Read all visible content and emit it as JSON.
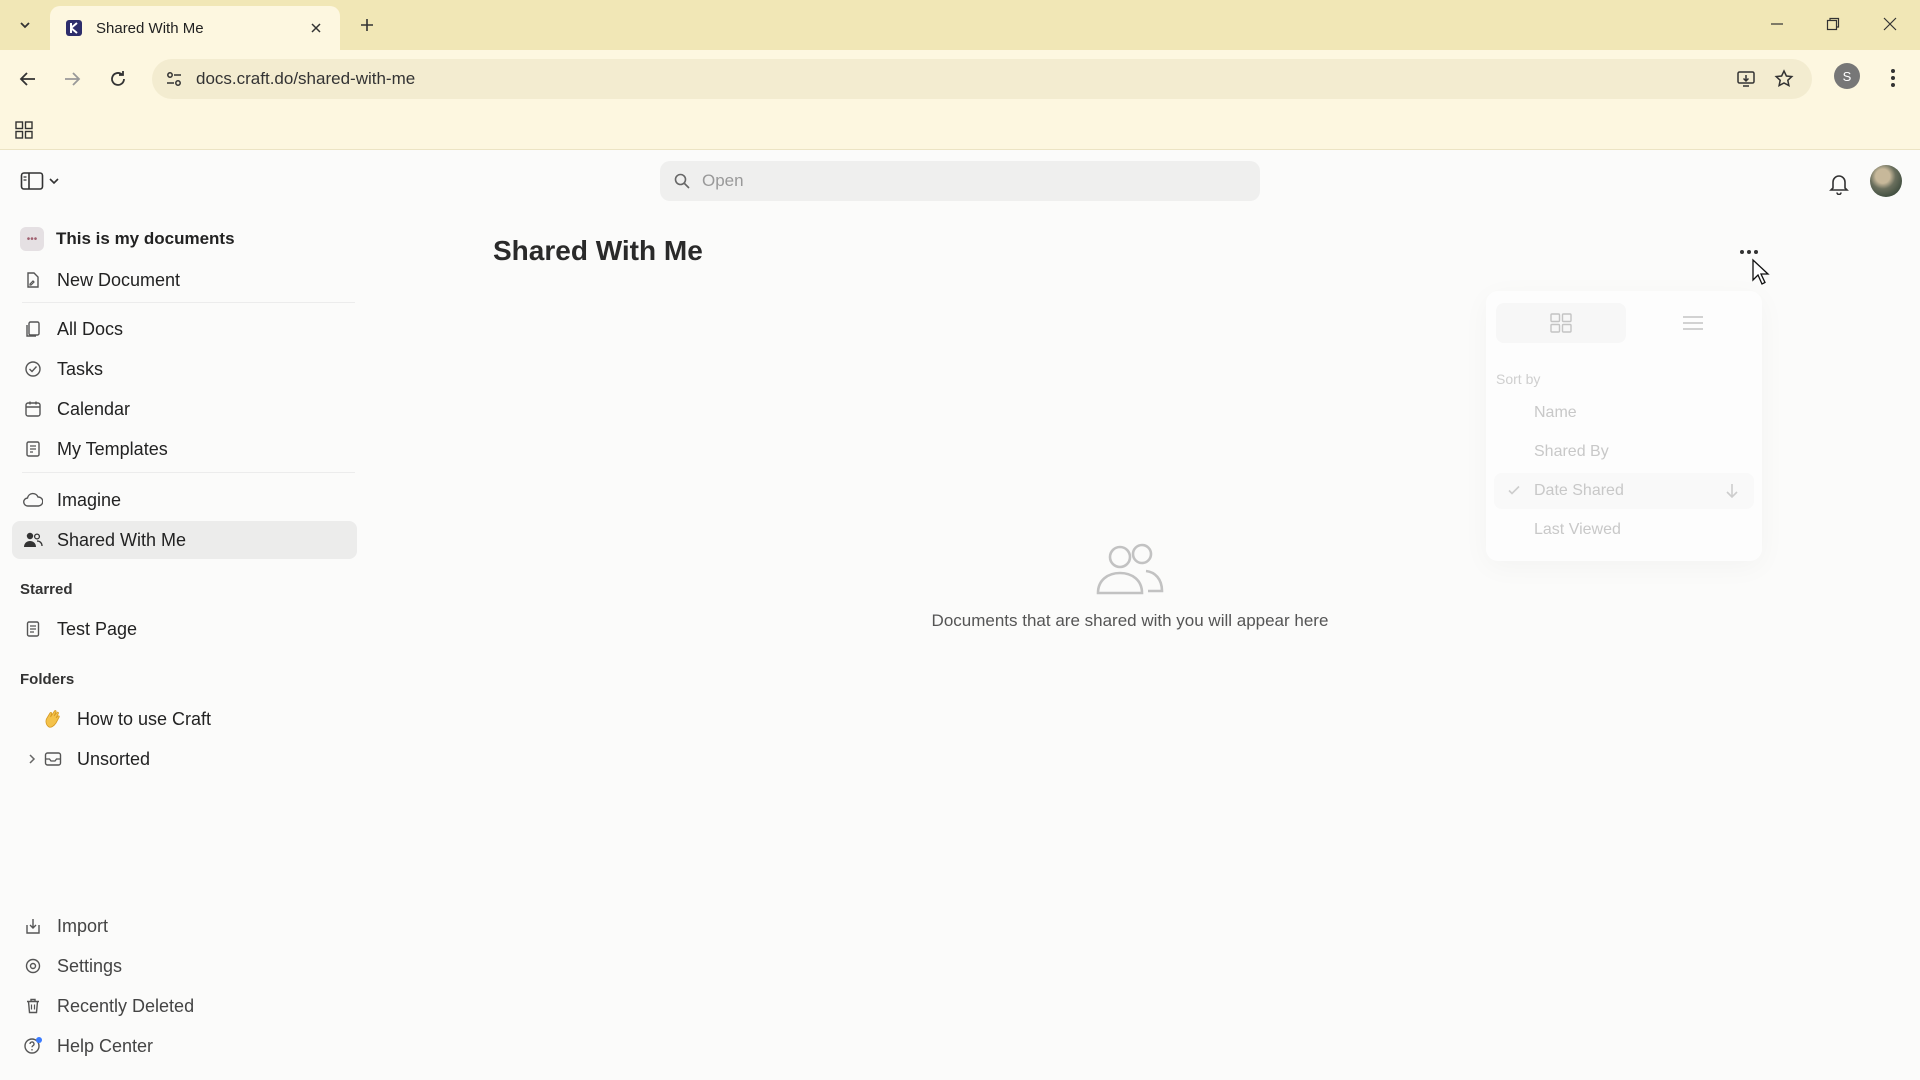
{
  "browser": {
    "tab_title": "Shared With Me",
    "url": "docs.craft.do/shared-with-me",
    "profile_initial": "S"
  },
  "topbar": {
    "search_placeholder": "Open"
  },
  "sidebar": {
    "space_name": "This is my documents",
    "new_document": "New Document",
    "nav": [
      {
        "label": "All Docs",
        "icon": "docs-icon"
      },
      {
        "label": "Tasks",
        "icon": "check-circle-icon"
      },
      {
        "label": "Calendar",
        "icon": "calendar-icon"
      },
      {
        "label": "My Templates",
        "icon": "template-icon"
      }
    ],
    "nav2": [
      {
        "label": "Imagine",
        "icon": "cloud-icon"
      },
      {
        "label": "Shared With Me",
        "icon": "shared-people-icon",
        "active": true
      }
    ],
    "starred_title": "Starred",
    "starred": [
      {
        "label": "Test Page",
        "icon": "page-icon"
      }
    ],
    "folders_title": "Folders",
    "folders": [
      {
        "label": "How to use Craft",
        "icon": "waving-hand-icon"
      },
      {
        "label": "Unsorted",
        "icon": "inbox-icon"
      }
    ],
    "bottom": [
      {
        "label": "Import",
        "icon": "import-icon"
      },
      {
        "label": "Settings",
        "icon": "gear-icon"
      },
      {
        "label": "Recently Deleted",
        "icon": "trash-icon"
      },
      {
        "label": "Help Center",
        "icon": "help-icon"
      }
    ]
  },
  "main": {
    "title": "Shared With Me",
    "empty_text": "Documents that are shared with you will appear here"
  },
  "menu": {
    "sort_caption": "Sort by",
    "items": [
      {
        "label": "Name"
      },
      {
        "label": "Shared By"
      },
      {
        "label": "Date Shared",
        "selected": true
      },
      {
        "label": "Last Viewed"
      }
    ]
  }
}
